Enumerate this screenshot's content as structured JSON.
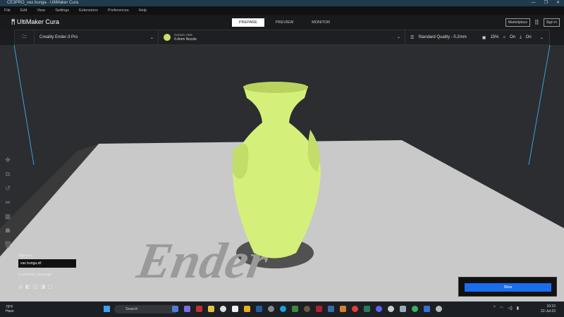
{
  "window": {
    "title": "CE3PRO_vas bunga - UltiMaker Cura"
  },
  "menu": [
    "File",
    "Edit",
    "View",
    "Settings",
    "Extensions",
    "Preferences",
    "Help"
  ],
  "header": {
    "logo": "UltiMaker Cura",
    "tabs": [
      {
        "label": "PREPARE",
        "active": true
      },
      {
        "label": "PREVIEW"
      },
      {
        "label": "MONITOR"
      }
    ],
    "marketplace": "Marketplace",
    "signin": "Sign in"
  },
  "toolbar": {
    "printer": "Creality Ender-3 Pro",
    "material": "Generic ABS",
    "nozzle": "0.4mm Nozzle",
    "quality": "Standard Quality - 0.2mm",
    "infill": "15%",
    "support": "On",
    "adhesion": "On"
  },
  "objects": {
    "list_label": "Object list",
    "file": "vas bunga.stl",
    "job_name": "CE3PRO_vas bunga"
  },
  "plate_text": "Ender",
  "slice": {
    "label": "Slice",
    "color": "#196ef0"
  },
  "taskbar": {
    "temp": "79°F",
    "weather": "Haze",
    "search": "Search",
    "time": "10:10",
    "date": "22-Jul-23"
  },
  "colors": {
    "model": "#d4f07a",
    "accent": "#196ef0"
  }
}
